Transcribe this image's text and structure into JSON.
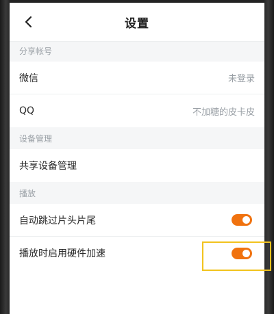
{
  "header": {
    "title": "设置"
  },
  "sections": [
    {
      "title": "分享帐号",
      "items": [
        {
          "label": "微信",
          "value": "未登录"
        },
        {
          "label": "QQ",
          "value": "不加糖的皮卡皮"
        }
      ]
    },
    {
      "title": "设备管理",
      "items": [
        {
          "label": "共享设备管理"
        }
      ]
    },
    {
      "title": "播放",
      "items": [
        {
          "label": "自动跳过片头片尾",
          "toggle_on": true
        },
        {
          "label": "播放时启用硬件加速",
          "toggle_on": true
        }
      ]
    }
  ],
  "colors": {
    "toggle_on": "#f0720f",
    "highlight": "#f2c31d",
    "section_bg": "#f5f6f7",
    "muted_text": "#9aa0a6"
  },
  "icons": {
    "back": "chevron-left-icon"
  }
}
